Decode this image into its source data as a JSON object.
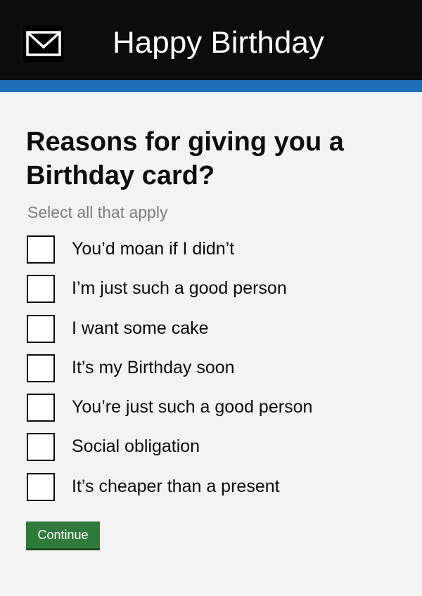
{
  "header": {
    "title": "Happy Birthday",
    "icon": "envelope-icon",
    "background_color": "#0b0c0c",
    "stripe_color": "#1d70b8"
  },
  "question": {
    "title": "Reasons for giving you a Birthday card?",
    "hint": "Select all that apply"
  },
  "options": [
    {
      "label": "You’d moan if I didn’t",
      "checked": false
    },
    {
      "label": "I’m just such a good person",
      "checked": false
    },
    {
      "label": "I want some cake",
      "checked": false
    },
    {
      "label": "It’s my Birthday soon",
      "checked": false
    },
    {
      "label": "You’re just such a good person",
      "checked": false
    },
    {
      "label": "Social obligation",
      "checked": false
    },
    {
      "label": "It’s cheaper than a present",
      "checked": false
    }
  ],
  "actions": {
    "continue_label": "Continue",
    "continue_color": "#2f7a3b"
  }
}
